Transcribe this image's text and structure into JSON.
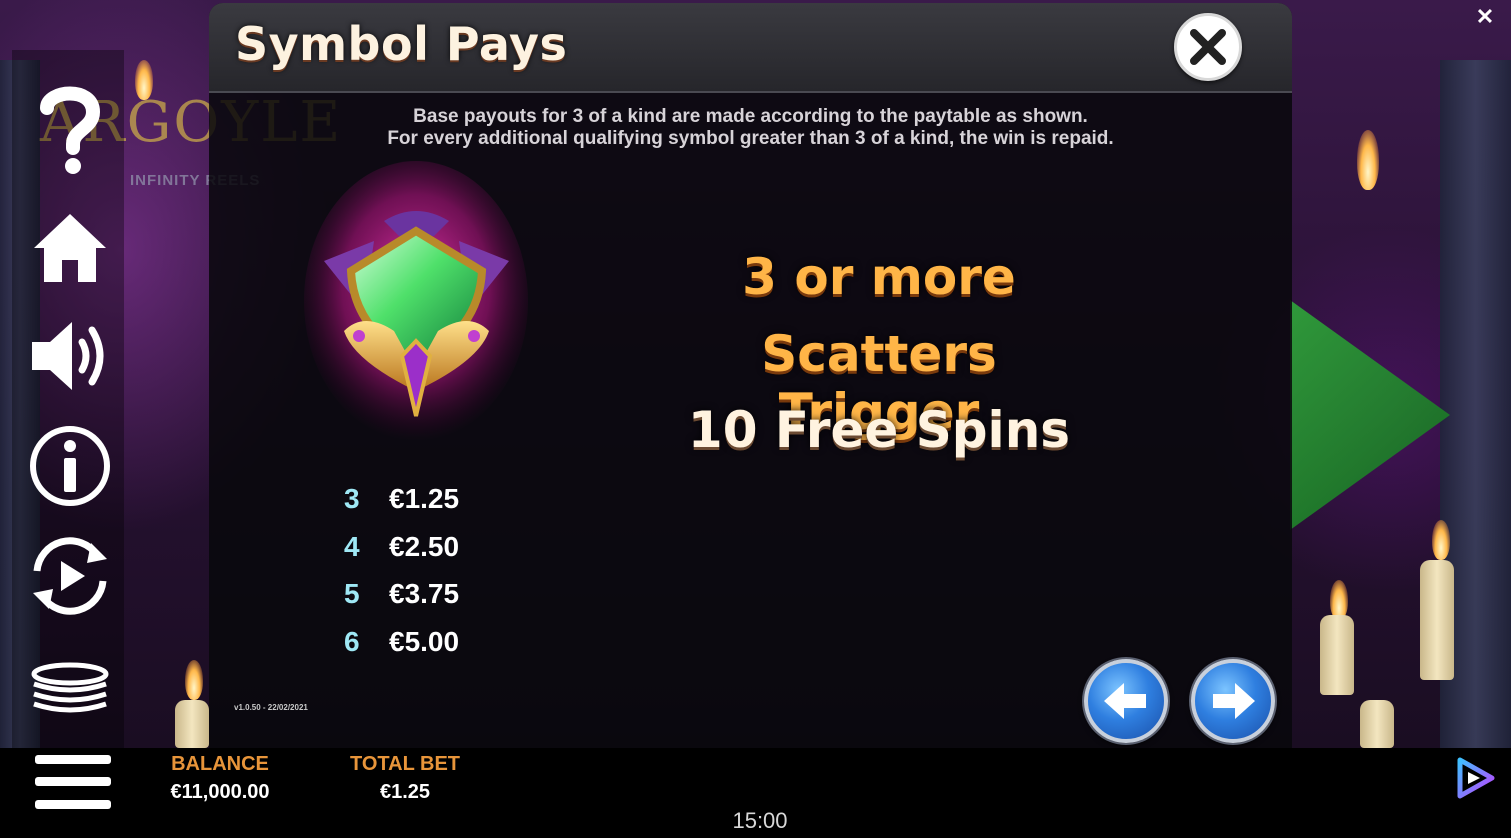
{
  "background": {
    "logo_text": "ARGOYLE",
    "logo_sub": "INFINITY REELS"
  },
  "left_menu": {
    "icons": [
      "help-icon",
      "home-icon",
      "sound-icon",
      "info-icon",
      "autoplay-icon",
      "bet-coins-icon"
    ]
  },
  "panel": {
    "title": "Symbol Pays",
    "description_line1": "Base payouts for 3 of a kind are made according to the paytable as shown.",
    "description_line2": "For every additional qualifying symbol greater than 3 of a kind, the win is repaid.",
    "symbol": "scatter-gem-icon",
    "paytable": [
      {
        "count": "3",
        "value": "€1.25"
      },
      {
        "count": "4",
        "value": "€2.50"
      },
      {
        "count": "5",
        "value": "€3.75"
      },
      {
        "count": "6",
        "value": "€5.00"
      }
    ],
    "trigger_line1": "3 or more",
    "trigger_line2": "Scatters Trigger",
    "trigger_line3": "10 Free Spins",
    "version": "v1.0.50 - 22/02/2021"
  },
  "bottom_bar": {
    "balance_label": "BALANCE",
    "balance_value": "€11,000.00",
    "total_bet_label": "TOTAL BET",
    "total_bet_value": "€1.25",
    "clock": "15:00"
  },
  "colors": {
    "accent_orange": "#e8953a",
    "trigger_orange": "#ffb547",
    "pay_count_cyan": "#9fe8f5",
    "nav_blue": "#2f7fe0"
  }
}
